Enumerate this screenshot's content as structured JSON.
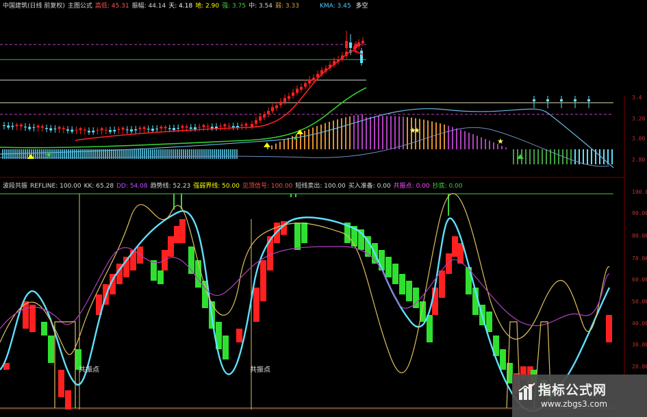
{
  "upper_header": {
    "items": [
      {
        "text": "中国建筑(日线 前复权)",
        "color": "#d8d8d8"
      },
      {
        "text": "主图公式",
        "color": "#d8d8d8"
      },
      {
        "text": "高低: 45.31",
        "color": "#ff5555"
      },
      {
        "text": "振幅: 44.14",
        "color": "#d8d8d8"
      },
      {
        "text": "天: 4.18",
        "color": "#ffffff"
      },
      {
        "text": "地: 2.90",
        "color": "#ffff00"
      },
      {
        "text": "强: 3.75",
        "color": "#40d040"
      },
      {
        "text": "中: 3.54",
        "color": "#d8d8d8"
      },
      {
        "text": "弱: 3.33",
        "color": "#d8a040"
      }
    ],
    "kma": {
      "text": "KMA: 3.45",
      "suffix": "多空",
      "color": "#4ad0ff",
      "suffix_color": "#ffffff"
    }
  },
  "upper_axis": [
    "3.20",
    "3.00",
    "2.80",
    "3.4"
  ],
  "lower_header": {
    "items": [
      {
        "text": "波段共振",
        "color": "#d8d8d8"
      },
      {
        "text": "REFLINE: 100.00",
        "color": "#d8d8d8"
      },
      {
        "text": "KK: 65.28",
        "color": "#d8d8d8"
      },
      {
        "text": "DD: 54.08",
        "color": "#c050ff"
      },
      {
        "text": "趋势线: 52.23",
        "color": "#d8d8d8"
      },
      {
        "text": "强弱界线: 50.00",
        "color": "#ffff00"
      },
      {
        "text": "见顶信号: 100.00",
        "color": "#ff5050"
      },
      {
        "text": "短线卖出: 100.00",
        "color": "#d8d8d8"
      },
      {
        "text": "买入准备: 0.00",
        "color": "#d8d8d8"
      },
      {
        "text": "共振点: 0.00",
        "color": "#ff50ff"
      },
      {
        "text": "抄底: 0.00",
        "color": "#40d040"
      }
    ]
  },
  "lower_axis": [
    "100.0",
    "90.00",
    "80.00",
    "70.00",
    "60.00",
    "50.00",
    "40.00",
    "30.00",
    "20.00"
  ],
  "markers": [
    "共振点",
    "共振点"
  ],
  "watermark": {
    "title": "指标公式网",
    "url": "www.zbgs3.com"
  },
  "colors": {
    "up": "#ff2020",
    "down": "#30e030",
    "cyan": "#60e0ff",
    "yellow": "#e0c060",
    "purple": "#b040c0",
    "orange": "#e09030"
  }
}
